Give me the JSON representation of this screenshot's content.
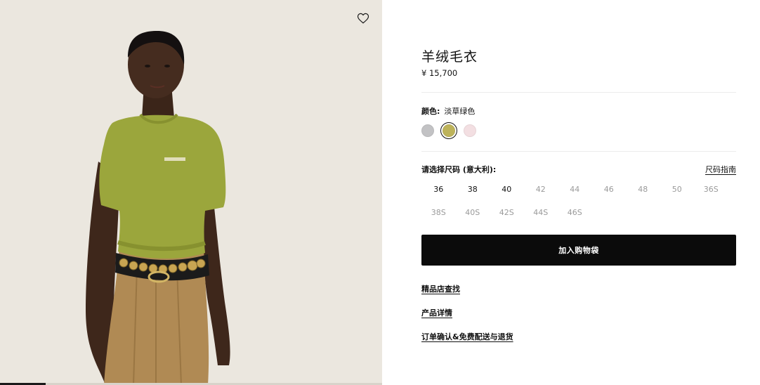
{
  "product": {
    "title": "羊绒毛衣",
    "price": "¥ 15,700"
  },
  "wishlist": {
    "icon": "heart-icon"
  },
  "image_gallery": {
    "progress": 0.12
  },
  "color": {
    "label": "颜色:",
    "selected_name": "淡草绿色",
    "swatches": [
      {
        "color": "#c2c2c4",
        "selected": false
      },
      {
        "color": "#bdb35a",
        "selected": true
      },
      {
        "color": "#f3dfe2",
        "selected": false
      }
    ]
  },
  "size": {
    "label": "请选择尺码 (意大利):",
    "guide_label": "尺码指南",
    "options": [
      {
        "label": "36",
        "available": true
      },
      {
        "label": "38",
        "available": true
      },
      {
        "label": "40",
        "available": true
      },
      {
        "label": "42",
        "available": false
      },
      {
        "label": "44",
        "available": false
      },
      {
        "label": "46",
        "available": false
      },
      {
        "label": "48",
        "available": false
      },
      {
        "label": "50",
        "available": false
      },
      {
        "label": "36S",
        "available": false
      },
      {
        "label": "38S",
        "available": false
      },
      {
        "label": "40S",
        "available": false
      },
      {
        "label": "42S",
        "available": false
      },
      {
        "label": "44S",
        "available": false
      },
      {
        "label": "46S",
        "available": false
      }
    ]
  },
  "actions": {
    "add_to_bag_label": "加入购物袋"
  },
  "links": [
    {
      "label": "精品店查找"
    },
    {
      "label": "产品详情"
    },
    {
      "label": "订单确认&免费配送与退货"
    }
  ]
}
